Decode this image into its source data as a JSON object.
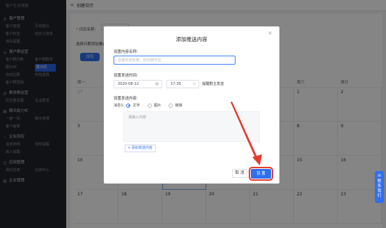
{
  "sidebar": {
    "top_item": "客户生命周期",
    "sections": [
      {
        "icon": "user-icon",
        "glyph": "♙",
        "title": "客户管理",
        "rows": [
          [
            "客户管理",
            "互动雷达"
          ],
          [
            "客户标签",
            "自定义信息"
          ],
          [
            "流失提醒",
            ""
          ]
        ]
      },
      {
        "icon": "group-icon",
        "glyph": "⌂",
        "title": "客户群运营",
        "rows": [
          [
            "客户群列表",
            "客户群群发"
          ],
          [
            "群SOP",
            "群日历"
          ],
          [
            "自动拉群",
            "标签建群"
          ],
          [
            "客户群营销",
            ""
          ]
        ]
      },
      {
        "icon": "broadcast-icon",
        "glyph": "◎",
        "title": "群发群运营",
        "rows": [
          [
            "历史朋友圈",
            "企业群发"
          ]
        ]
      },
      {
        "icon": "chat-icon",
        "glyph": "▤",
        "title": "聊天助力栏",
        "rows": [
          [
            "一客一码",
            "聊天增强"
          ],
          [
            "客户画像",
            ""
          ]
        ]
      },
      {
        "icon": "shield-icon",
        "glyph": "♢",
        "title": "企业风控",
        "rows": [
          [
            "消息存档",
            "违规提醒"
          ],
          [
            "离人提醒",
            ""
          ]
        ]
      },
      {
        "icon": "app-icon",
        "glyph": "◫",
        "title": "应用管理",
        "rows": [
          [
            "我的应用",
            "应用中心"
          ]
        ]
      },
      {
        "icon": "building-icon",
        "glyph": "▥",
        "title": "企业管理",
        "rows": []
      }
    ],
    "active_item": "群日历"
  },
  "header": {
    "back_glyph": "<",
    "title": "创建日历"
  },
  "form": {
    "name_label": "日历名称:",
    "date_label": "选择日期添加推送",
    "button_label": "日历",
    "dot_label": "●"
  },
  "calendar": {
    "weekdays": [
      "周一",
      "",
      "",
      "",
      "",
      "周六",
      "周日"
    ],
    "weeks": [
      [
        "27",
        "",
        "",
        "",
        "",
        "1",
        "2"
      ],
      [
        "3",
        "",
        "",
        "",
        "",
        "8",
        "9"
      ],
      [
        "10",
        "",
        "",
        "",
        "",
        "15",
        "16"
      ],
      [
        "17",
        "18",
        "19",
        "20",
        "21",
        "22",
        "23"
      ]
    ]
  },
  "float_button": "联系我们",
  "modal": {
    "title": "添加推送内容",
    "close": "×",
    "name_label": "设置内容名称:",
    "name_placeholder": "设置内容名称，仅内部可见",
    "time_label": "设置发送时间:",
    "date_value": "2020-08-12",
    "time_value": "17:35",
    "notify_text": "提醒群主发送",
    "content_label": "设置发送内容:",
    "message_label": "消息1:",
    "types": [
      "文字",
      "图片",
      "链接"
    ],
    "selected_type": 0,
    "textarea_placeholder": "请输入内容",
    "add_content": "+ 添加发送内容",
    "cancel": "取 消",
    "ok": "设 置"
  }
}
